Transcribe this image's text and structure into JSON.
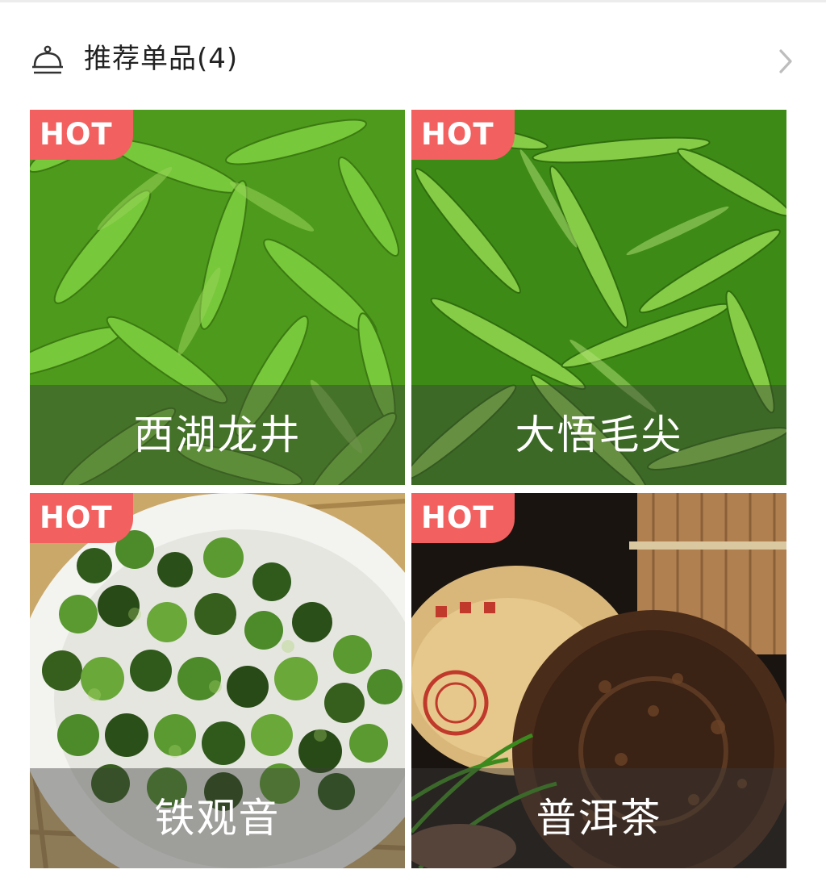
{
  "header": {
    "title": "推荐单品(4)",
    "icon": "cloche-icon",
    "more_icon": "chevron-right-icon"
  },
  "products": [
    {
      "badge": "HOT",
      "name": "西湖龙井",
      "image": "green-tea-leaves"
    },
    {
      "badge": "HOT",
      "name": "大悟毛尖",
      "image": "green-tea-needles"
    },
    {
      "badge": "HOT",
      "name": "铁观音",
      "image": "rolled-oolong-in-white-dish"
    },
    {
      "badge": "HOT",
      "name": "普洱茶",
      "image": "pu-erh-tea-cake"
    }
  ],
  "colors": {
    "badge": "#f2605f",
    "title": "#222222",
    "chevron": "#bdbdbd"
  }
}
